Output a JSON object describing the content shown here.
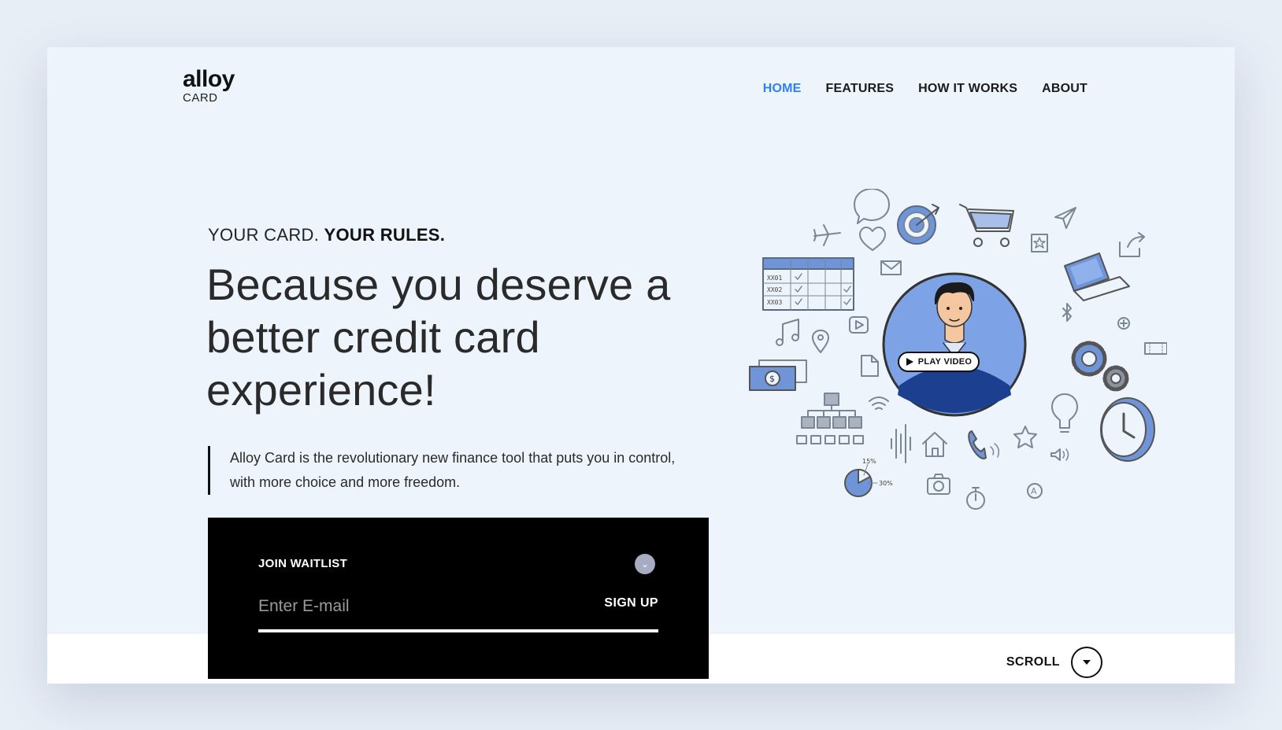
{
  "brand": {
    "name": "alloy",
    "subname": "CARD"
  },
  "nav": {
    "items": [
      {
        "label": "HOME",
        "active": true
      },
      {
        "label": "FEATURES",
        "active": false
      },
      {
        "label": "HOW IT WORKS",
        "active": false
      },
      {
        "label": "ABOUT",
        "active": false
      }
    ]
  },
  "hero": {
    "eyebrow_regular": "YOUR CARD.",
    "eyebrow_bold": "YOUR RULES.",
    "headline": "Because you deserve a better credit card experience!",
    "lead": "Alloy Card is the revolutionary new finance tool that puts you in control, with more choice and more freedom."
  },
  "waitlist": {
    "title": "JOIN WAITLIST",
    "email_placeholder": "Enter E-mail",
    "email_value": "",
    "signup_label": "SIGN UP"
  },
  "video": {
    "play_label": "PLAY VIDEO"
  },
  "scroll": {
    "label": "SCROLL"
  },
  "illustration": {
    "table_rows": [
      "XX01",
      "XX02",
      "XX03"
    ],
    "pie_labels": [
      "15%",
      "30%"
    ],
    "icons": [
      "speech-bubble-icon",
      "target-icon",
      "shopping-cart-icon",
      "paper-plane-icon",
      "airplane-icon",
      "heart-icon",
      "star-box-icon",
      "share-icon",
      "envelope-icon",
      "laptop-icon",
      "bluetooth-icon",
      "plus-icon",
      "music-note-icon",
      "play-icon",
      "map-pin-icon",
      "gears-icon",
      "ticket-icon",
      "money-icon",
      "document-icon",
      "wifi-icon",
      "sitemap-icon",
      "lightbulb-icon",
      "clock-icon",
      "soundwave-icon",
      "home-icon",
      "phone-icon",
      "star-icon",
      "speaker-icon",
      "pie-chart-icon",
      "camera-icon",
      "stopwatch-icon",
      "at-icon"
    ]
  },
  "colors": {
    "accent": "#2f80ed",
    "illustration_blue": "#6f94d8",
    "background": "#edf4fc"
  }
}
